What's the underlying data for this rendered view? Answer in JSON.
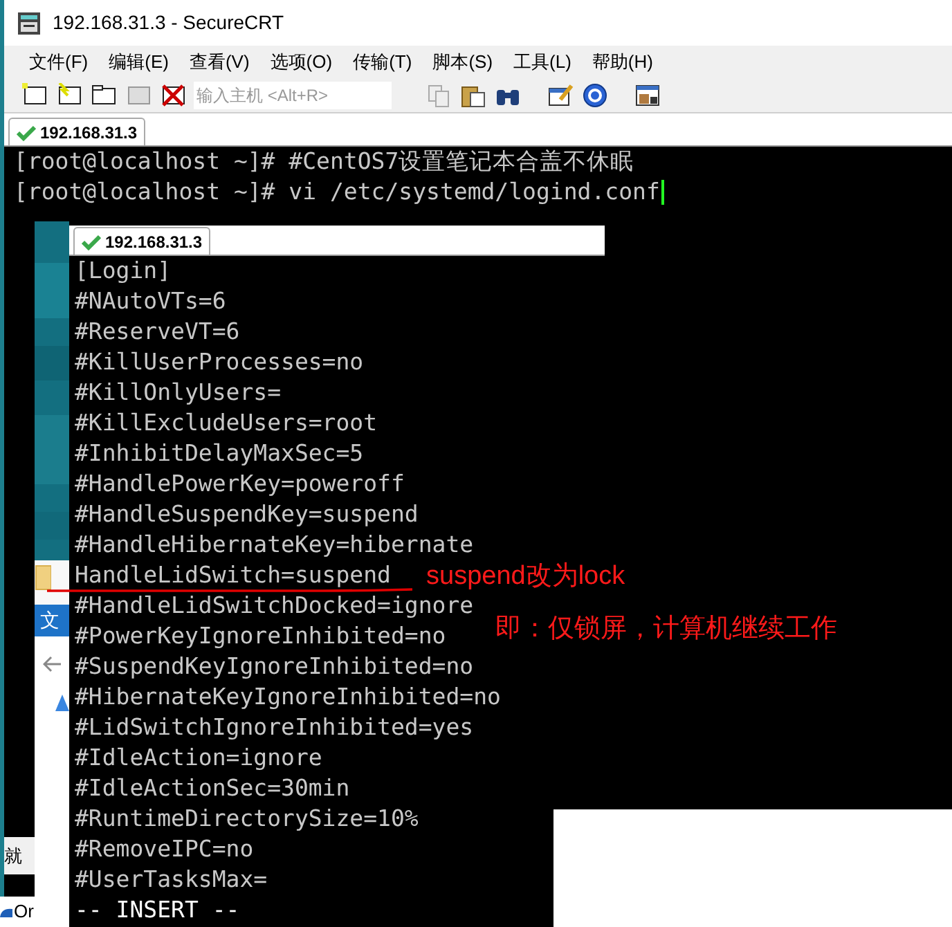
{
  "window": {
    "title": "192.168.31.3 - SecureCRT"
  },
  "menu": [
    "文件(F)",
    "编辑(E)",
    "查看(V)",
    "选项(O)",
    "传输(T)",
    "脚本(S)",
    "工具(L)",
    "帮助(H)"
  ],
  "toolbar": {
    "host_placeholder": "输入主机 <Alt+R>"
  },
  "tabs": [
    {
      "label": "192.168.31.3",
      "selected": true
    }
  ],
  "terminal_lines": [
    "[root@localhost ~]# #CentOS7设置笔记本合盖不休眠",
    "[root@localhost ~]# vi /etc/systemd/logind.conf"
  ],
  "inner_window": {
    "tabs": [
      {
        "label": "192.168.31.3",
        "selected": true
      }
    ],
    "lines": [
      "[Login]",
      "#NAutoVTs=6",
      "#ReserveVT=6",
      "#KillUserProcesses=no",
      "#KillOnlyUsers=",
      "#KillExcludeUsers=root",
      "#InhibitDelayMaxSec=5",
      "#HandlePowerKey=poweroff",
      "#HandleSuspendKey=suspend",
      "#HandleHibernateKey=hibernate",
      "HandleLidSwitch=suspend",
      "#HandleLidSwitchDocked=ignore",
      "#PowerKeyIgnoreInhibited=no",
      "#SuspendKeyIgnoreInhibited=no",
      "#HibernateKeyIgnoreInhibited=no",
      "#LidSwitchIgnoreInhibited=yes",
      "#IdleAction=ignore",
      "#IdleActionSec=30min",
      "#RuntimeDirectorySize=10%",
      "#RemoveIPC=no",
      "#UserTasksMax="
    ],
    "mode_line": "-- INSERT --"
  },
  "annotations": [
    "suspend改为lock",
    "即：仅锁屏，计算机继续工作"
  ],
  "background_fragments": [
    "文",
    "就",
    "Or"
  ]
}
